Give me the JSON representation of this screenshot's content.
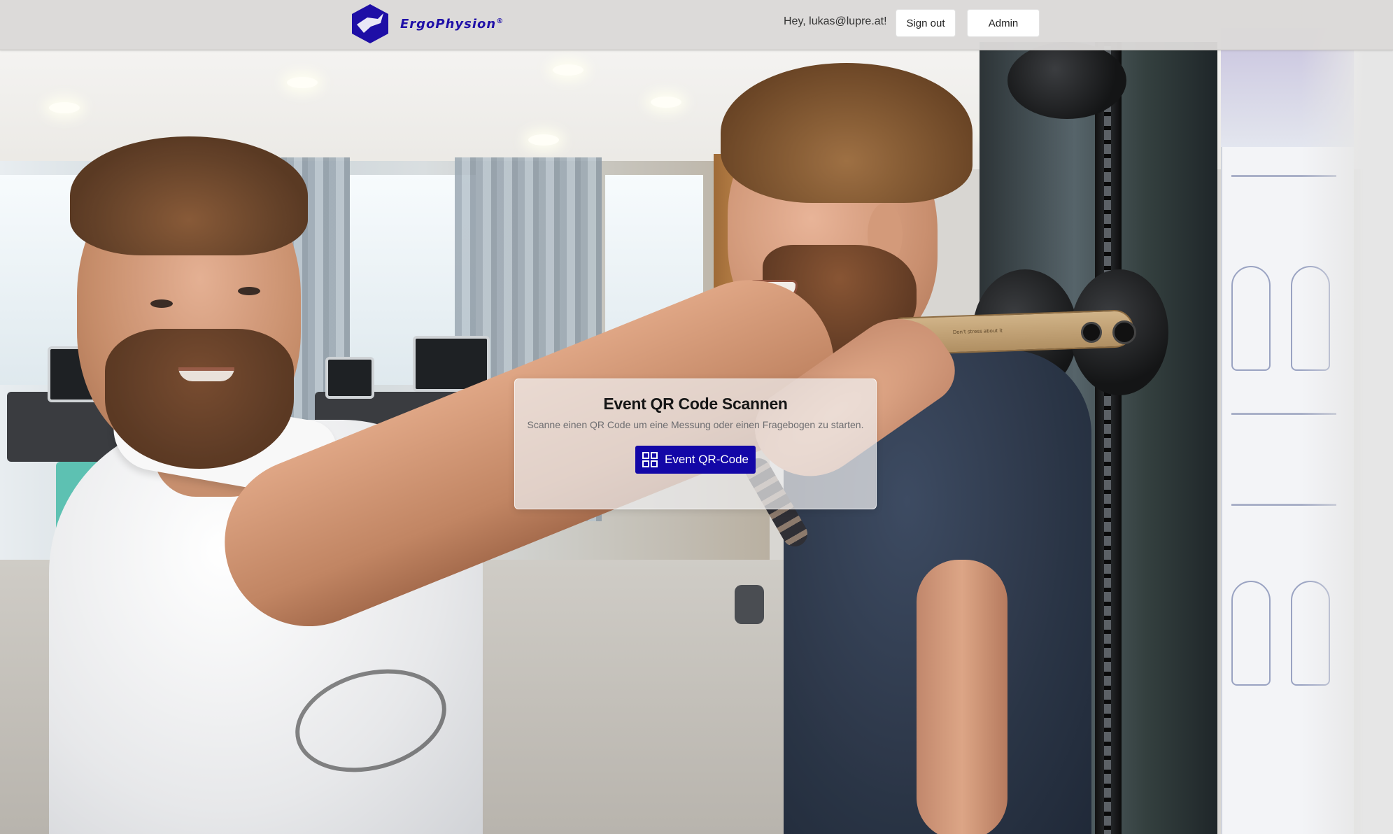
{
  "header": {
    "brand_name": "ErgoPhysion",
    "brand_mark": "®",
    "greeting": "Hey, lukas@lupre.at!",
    "signout_label": "Sign out",
    "admin_label": "Admin"
  },
  "card": {
    "title": "Event QR Code Scannen",
    "subtitle": "Scanne einen QR Code um eine Messung oder einen Fragebogen zu starten.",
    "button_label": "Event QR-Code",
    "button_icon": "qr-code-icon"
  },
  "background": {
    "equipment_label": "Don't stress about it"
  },
  "colors": {
    "brand": "#2011a8",
    "primary_button": "#1307a7",
    "header_bg": "#dcdad8"
  }
}
